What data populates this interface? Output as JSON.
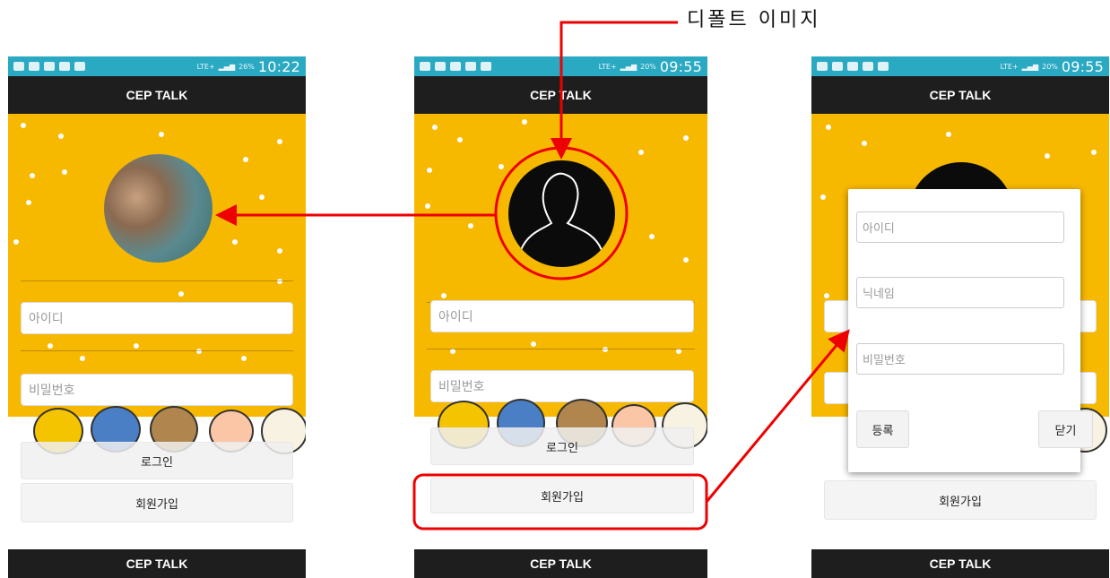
{
  "annotation": {
    "label": "디폴트 이미지"
  },
  "colors": {
    "statusbar": "#2aa9c2",
    "appbar": "#1e1e1e",
    "background": "#f7b800",
    "highlight": "#ee0000"
  },
  "phones": [
    {
      "status": {
        "time": "10:22",
        "battery": "26%",
        "network": "LTE+"
      },
      "app_title": "CEP TALK",
      "avatar": "profile-photo",
      "id_placeholder": "아이디",
      "pw_placeholder": "비밀번호",
      "login_label": "로그인",
      "signup_label": "회원가입",
      "footer_title": "CEP TALK"
    },
    {
      "status": {
        "time": "09:55",
        "battery": "20%",
        "network": "LTE+"
      },
      "app_title": "CEP TALK",
      "avatar": "default-person-icon",
      "id_placeholder": "아이디",
      "pw_placeholder": "비밀번호",
      "login_label": "로그인",
      "signup_label": "회원가입",
      "footer_title": "CEP TALK"
    },
    {
      "status": {
        "time": "09:55",
        "battery": "20%",
        "network": "LTE+"
      },
      "app_title": "CEP TALK",
      "dialog": {
        "id_placeholder": "아이디",
        "nickname_placeholder": "닉네임",
        "pw_placeholder": "비밀번호",
        "register_label": "등록",
        "close_label": "닫기"
      },
      "signup_label": "회원가입",
      "footer_title": "CEP TALK"
    }
  ]
}
